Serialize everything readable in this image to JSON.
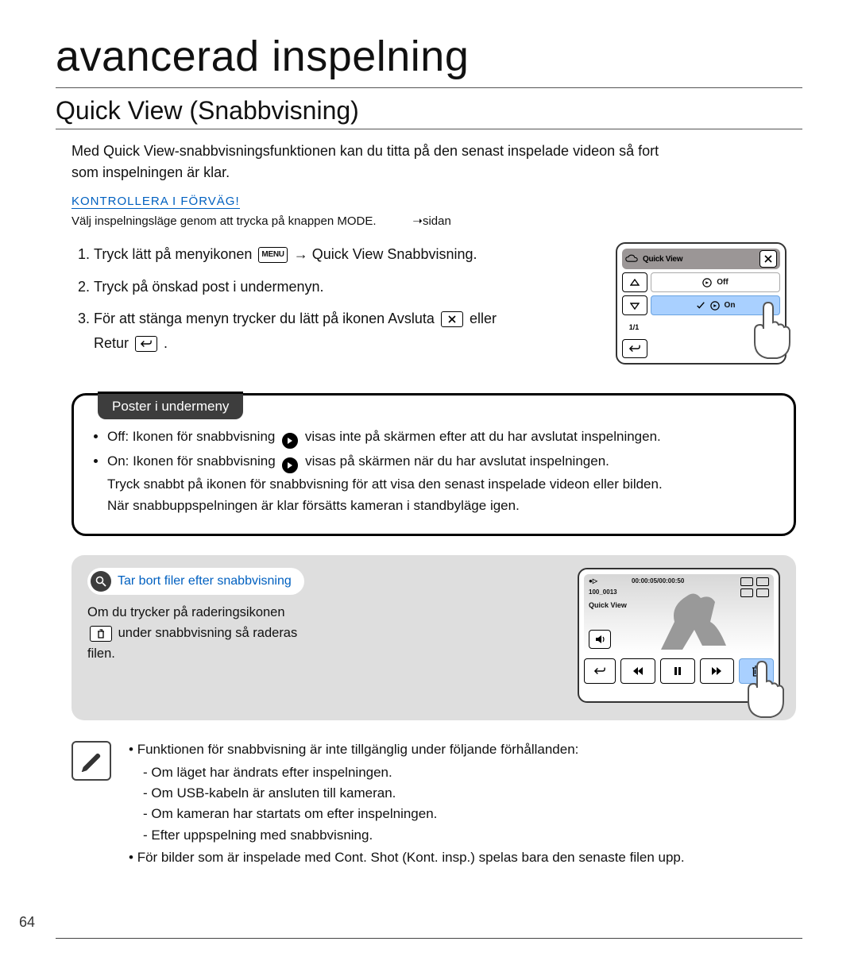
{
  "page_number": "64",
  "title": "avancerad inspelning",
  "subsection": "Quick View (Snabbvisning)",
  "intro_line1": "Med Quick View-snabbvisningsfunktionen kan du titta på den senast inspelade videon så fort",
  "intro_line2": "som inspelningen är klar.",
  "preflight_label": "KONTROLLERA I FÖRVÄG!",
  "preflight_line_a": "Välj inspelningsläge genom att trycka på knappen ",
  "preflight_mode": "MODE",
  "preflight_line_b": ".",
  "preflight_ref": "➝sidan",
  "steps": {
    "s1_a": "Tryck lätt på menyikonen ",
    "menu_icon_label": "MENU",
    "s1_b": " ",
    "qv": "Quick View",
    "s1_c": " Snabbvisning.",
    "s2": "Tryck på önskad post i undermenyn.",
    "s3_a": "För att stänga menyn trycker du lätt på ikonen Avsluta",
    "s3_b": " eller",
    "s3_c": "Retur ",
    "s3_d": "."
  },
  "device_menu": {
    "title": "Quick View",
    "row_off": "Off",
    "row_on": "On",
    "page": "1/1"
  },
  "poster": {
    "tab": "Poster i undermeny",
    "bullet_off_a": "Off: Ikonen för snabbvisning ",
    "bullet_off_b": " visas inte på skärmen efter att du har avslutat inspelningen.",
    "bullet_on_a": "On: Ikonen för snabbvisning ",
    "bullet_on_b": " visas på skärmen när du har avslutat inspelningen.",
    "line2": "Tryck snabbt på ikonen för snabbvisning för att visa den senast inspelade videon eller bilden.",
    "line3": "När snabbuppspelningen är klar försätts kameran i standbyläge igen."
  },
  "tip": {
    "chip": "Tar bort filer efter snabbvisning",
    "line1": "Om du trycker på raderingsikonen",
    "line2a": " ",
    "line2b": "under snabbvisning så raderas",
    "line3": "filen."
  },
  "device_play": {
    "rec_icon": "●▷",
    "time": "00:00:05/00:00:50",
    "file_no": "100_0013",
    "qv_label": "Quick View"
  },
  "note": {
    "intro": "Funktionen för snabbvisning är inte tillgänglig under följande förhållanden:",
    "n1": "Om läget har ändrats efter inspelningen.",
    "n2": "Om USB-kabeln är ansluten till kameran.",
    "n3": "Om kameran har startats om efter inspelningen.",
    "n4": "Efter uppspelning med snabbvisning.",
    "last_a": "För bilder som är inspelade med ",
    "last_b": "Cont. Shot",
    "last_c": " (Kont. insp.) spelas bara den senaste filen upp."
  }
}
